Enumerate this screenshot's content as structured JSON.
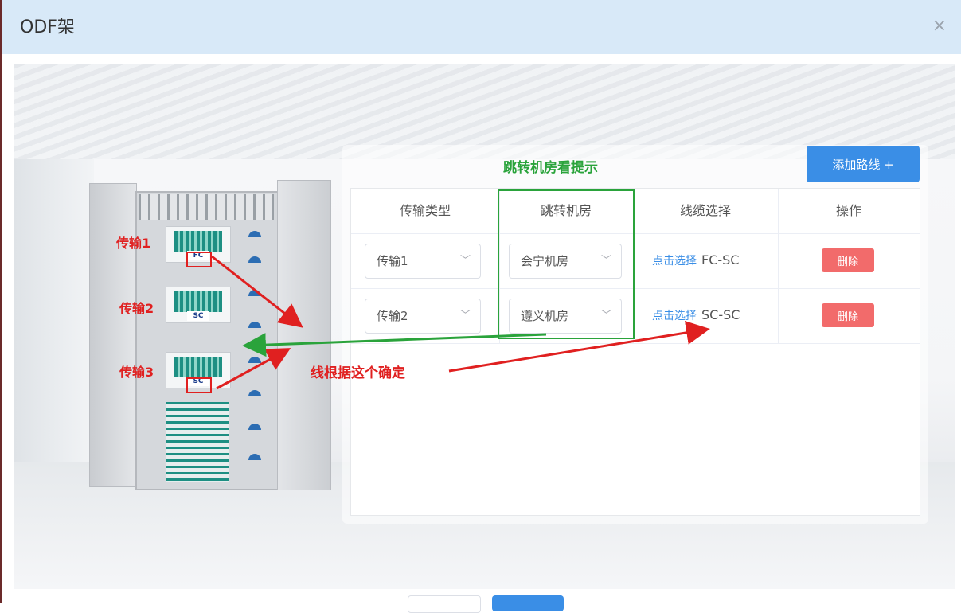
{
  "dialog": {
    "title": "ODF架",
    "close_label": "×"
  },
  "cabinet": {
    "labels": [
      "传输1",
      "传输2",
      "传输3"
    ],
    "plates": [
      "FC",
      "SC",
      "SC"
    ]
  },
  "annotations": {
    "jump_hint": "跳转机房看提示",
    "line_hint": "线根据这个确定"
  },
  "toolbar": {
    "add_route_label": "添加路线 +"
  },
  "table": {
    "headers": [
      "传输类型",
      "跳转机房",
      "线缆选择",
      "操作"
    ],
    "rows": [
      {
        "transmission": "传输1",
        "room": "会宁机房",
        "link": "点击选择",
        "cable": "FC-SC",
        "action": "删除"
      },
      {
        "transmission": "传输2",
        "room": "遵义机房",
        "link": "点击选择",
        "cable": "SC-SC",
        "action": "删除"
      }
    ]
  },
  "colors": {
    "primary": "#3a8ee6",
    "danger": "#f26b6b",
    "annotation_red": "#e02020",
    "annotation_green": "#2aa33b",
    "header_bg": "#d8e9f8"
  },
  "icons": {
    "close": "close-icon",
    "chevron": "chevron-down-icon"
  }
}
